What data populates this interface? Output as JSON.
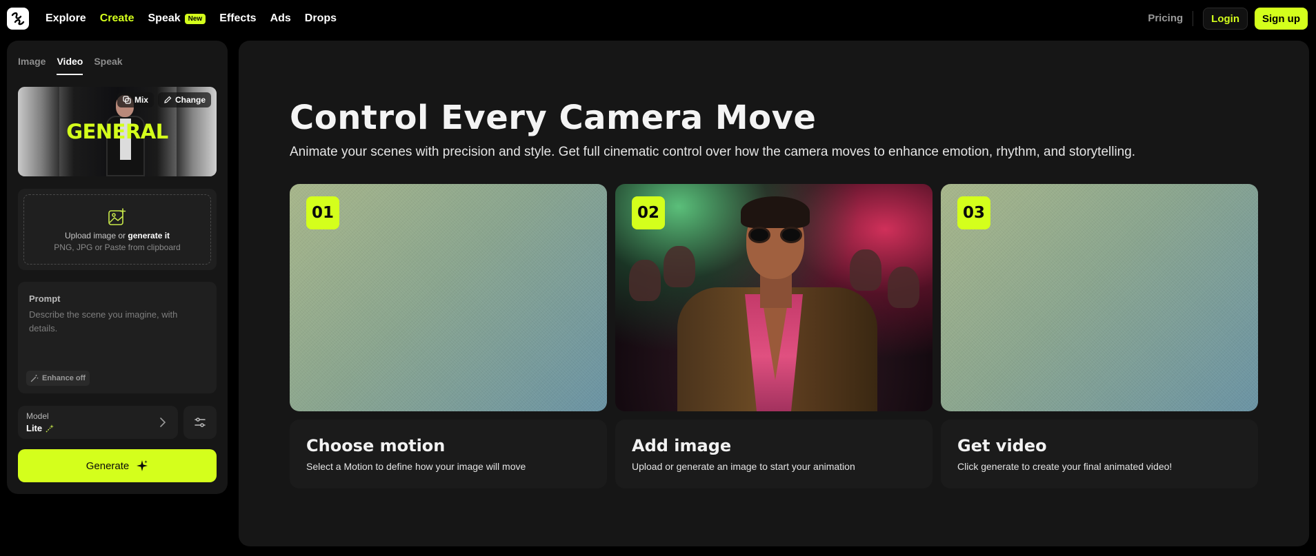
{
  "nav": {
    "items": [
      {
        "label": "Explore"
      },
      {
        "label": "Create"
      },
      {
        "label": "Speak"
      },
      {
        "label": "Effects"
      },
      {
        "label": "Ads"
      },
      {
        "label": "Drops"
      }
    ],
    "new_badge": "New",
    "pricing": "Pricing",
    "login": "Login",
    "signup": "Sign up"
  },
  "sidebar": {
    "tabs": [
      {
        "label": "Image"
      },
      {
        "label": "Video"
      },
      {
        "label": "Speak"
      }
    ],
    "active_tab": "Video",
    "preview": {
      "title": "GENERAL",
      "mix_label": "Mix",
      "change_label": "Change"
    },
    "upload": {
      "text": "Upload image or",
      "link": "generate it",
      "hint": "PNG, JPG or Paste from clipboard"
    },
    "prompt": {
      "label": "Prompt",
      "placeholder": "Describe the scene you imagine, with details.",
      "enhance": "Enhance off"
    },
    "model": {
      "label": "Model",
      "value": "Lite"
    },
    "generate": "Generate"
  },
  "main": {
    "title": "Control Every Camera Move",
    "subtitle": "Animate your scenes with precision and style. Get full cinematic control over how the camera moves to enhance emotion, rhythm, and storytelling.",
    "steps": [
      {
        "number": "01",
        "title": "Choose motion",
        "desc": "Select a Motion to define how your image will move"
      },
      {
        "number": "02",
        "title": "Add image",
        "desc": "Upload or generate an image to start your animation"
      },
      {
        "number": "03",
        "title": "Get video",
        "desc": "Click generate to create your final animated video!"
      }
    ]
  },
  "colors": {
    "accent": "#d4ff1c",
    "background": "#000000",
    "panel": "#161616"
  }
}
